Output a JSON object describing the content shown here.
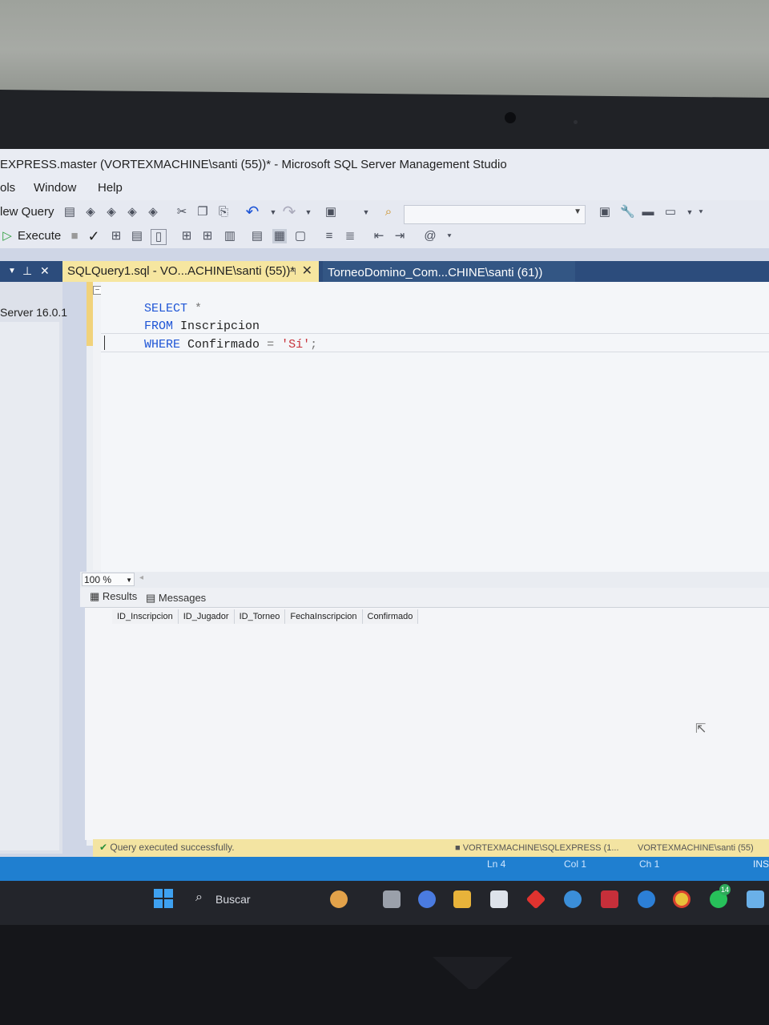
{
  "window": {
    "title": "EXPRESS.master (VORTEXMACHINE\\santi (55))* - Microsoft SQL Server Management Studio"
  },
  "menu": {
    "items": [
      "ols",
      "Window",
      "Help"
    ]
  },
  "toolbar": {
    "new_query_label": "lew Query",
    "execute_label": "Execute"
  },
  "left_panel": {
    "server_text": "Server 16.0.1"
  },
  "tabs": [
    {
      "label": "SQLQuery1.sql - VO...ACHINE\\santi (55))*",
      "active": true
    },
    {
      "label": "TorneoDomino_Com...CHINE\\santi (61))",
      "active": false
    }
  ],
  "editor": {
    "lines": [
      {
        "kw": "SELECT",
        "rest": " *"
      },
      {
        "kw": "FROM",
        "rest": " Inscripcion"
      },
      {
        "kw": "WHERE",
        "rest": " Confirmado ",
        "op": "=",
        "str": "'Sí'",
        "end": ";"
      }
    ],
    "zoom": "100 %"
  },
  "results": {
    "tabs": [
      "Results",
      "Messages"
    ],
    "columns": [
      "ID_Inscripcion",
      "ID_Jugador",
      "ID_Torneo",
      "FechaInscripcion",
      "Confirmado"
    ]
  },
  "status": {
    "message": "Query executed successfully.",
    "server": "VORTEXMACHINE\\SQLEXPRESS (1...",
    "user": "VORTEXMACHINE\\santi (55)",
    "ln": "Ln 4",
    "col": "Col 1",
    "ch": "Ch 1",
    "mode": "INS"
  },
  "taskbar": {
    "search_label": "Buscar",
    "badge": "14"
  }
}
